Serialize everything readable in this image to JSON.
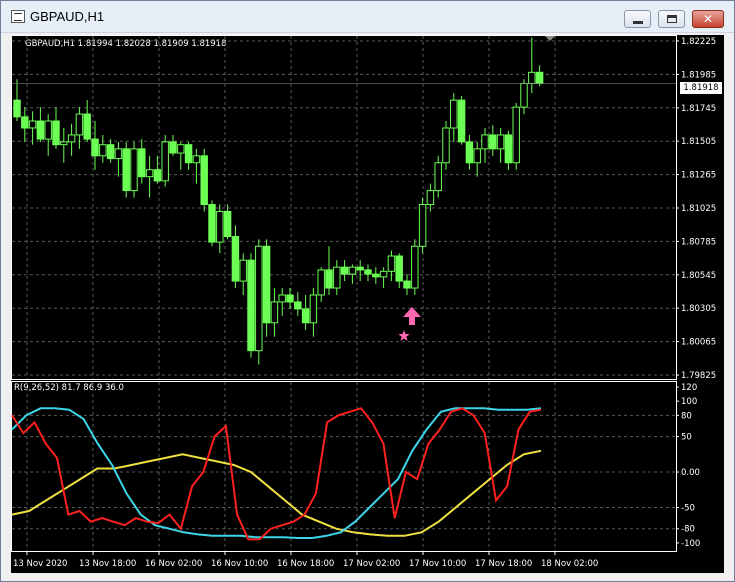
{
  "window": {
    "title": "GBPAUD,H1"
  },
  "price_chart": {
    "header": "GBPAUD,H1  1.81994 1.82028 1.81909 1.81918",
    "current_price": "1.81918",
    "price_axis": [
      "1.82225",
      "1.81985",
      "1.81745",
      "1.81505",
      "1.81265",
      "1.81025",
      "1.80785",
      "1.80545",
      "1.80305",
      "1.80065",
      "1.79825"
    ],
    "bull_color": "#6cff54",
    "candle_color_note": "green outline candles",
    "arrow_color": "#ff69b4",
    "star_color": "#ff69b4"
  },
  "indicator": {
    "header": "R(9,26,52) 81.7 86.9 36.0",
    "axis": [
      "120",
      "100",
      "80",
      "50",
      "0.00",
      "-50",
      "-80",
      "-100"
    ],
    "line_colors": [
      "#ff2020",
      "#3cd6e8",
      "#f0e040"
    ]
  },
  "time_axis": [
    "13 Nov 2020",
    "13 Nov 18:00",
    "16 Nov 02:00",
    "16 Nov 10:00",
    "16 Nov 18:00",
    "17 Nov 02:00",
    "17 Nov 10:00",
    "17 Nov 18:00",
    "18 Nov 02:00"
  ],
  "chart_data": {
    "type": "candlestick",
    "candles": [
      [
        1.818,
        1.8195,
        1.8165,
        1.8168
      ],
      [
        1.8168,
        1.8175,
        1.815,
        1.816
      ],
      [
        1.816,
        1.8172,
        1.8148,
        1.8165
      ],
      [
        1.8165,
        1.8175,
        1.815,
        1.8152
      ],
      [
        1.8152,
        1.817,
        1.814,
        1.8165
      ],
      [
        1.8165,
        1.8175,
        1.8145,
        1.8148
      ],
      [
        1.8148,
        1.816,
        1.8135,
        1.815
      ],
      [
        1.815,
        1.8163,
        1.814,
        1.8155
      ],
      [
        1.8155,
        1.8175,
        1.8145,
        1.817
      ],
      [
        1.817,
        1.818,
        1.815,
        1.8152
      ],
      [
        1.8152,
        1.8165,
        1.813,
        1.814
      ],
      [
        1.814,
        1.8155,
        1.8135,
        1.8148
      ],
      [
        1.8148,
        1.8152,
        1.8135,
        1.8138
      ],
      [
        1.8138,
        1.815,
        1.8125,
        1.8145
      ],
      [
        1.8145,
        1.815,
        1.811,
        1.8115
      ],
      [
        1.8115,
        1.815,
        1.811,
        1.8145
      ],
      [
        1.8145,
        1.8152,
        1.812,
        1.8125
      ],
      [
        1.8125,
        1.814,
        1.811,
        1.813
      ],
      [
        1.813,
        1.814,
        1.812,
        1.8122
      ],
      [
        1.8122,
        1.8155,
        1.8118,
        1.815
      ],
      [
        1.815,
        1.8155,
        1.814,
        1.8142
      ],
      [
        1.8142,
        1.815,
        1.813,
        1.8148
      ],
      [
        1.8148,
        1.815,
        1.813,
        1.8135
      ],
      [
        1.8135,
        1.8145,
        1.812,
        1.814
      ],
      [
        1.814,
        1.8145,
        1.81,
        1.8105
      ],
      [
        1.8105,
        1.8108,
        1.8075,
        1.8078
      ],
      [
        1.8078,
        1.8105,
        1.807,
        1.81
      ],
      [
        1.81,
        1.8105,
        1.808,
        1.8082
      ],
      [
        1.8082,
        1.809,
        1.8045,
        1.805
      ],
      [
        1.805,
        1.807,
        1.804,
        1.8065
      ],
      [
        1.8065,
        1.807,
        1.7995,
        1.8
      ],
      [
        1.8,
        1.808,
        1.799,
        1.8075
      ],
      [
        1.8075,
        1.808,
        1.801,
        1.802
      ],
      [
        1.802,
        1.8045,
        1.801,
        1.8035
      ],
      [
        1.8035,
        1.8045,
        1.8025,
        1.804
      ],
      [
        1.804,
        1.8045,
        1.803,
        1.8035
      ],
      [
        1.8035,
        1.8042,
        1.8025,
        1.803
      ],
      [
        1.803,
        1.804,
        1.8015,
        1.802
      ],
      [
        1.802,
        1.8045,
        1.801,
        1.804
      ],
      [
        1.804,
        1.806,
        1.8035,
        1.8058
      ],
      [
        1.8058,
        1.8075,
        1.804,
        1.8045
      ],
      [
        1.8045,
        1.8065,
        1.804,
        1.806
      ],
      [
        1.806,
        1.8065,
        1.805,
        1.8055
      ],
      [
        1.8055,
        1.8062,
        1.8048,
        1.806
      ],
      [
        1.806,
        1.8065,
        1.805,
        1.8058
      ],
      [
        1.8058,
        1.8062,
        1.805,
        1.8055
      ],
      [
        1.8055,
        1.806,
        1.8048,
        1.8053
      ],
      [
        1.8053,
        1.806,
        1.8045,
        1.8057
      ],
      [
        1.8057,
        1.8072,
        1.805,
        1.8068
      ],
      [
        1.8068,
        1.807,
        1.8045,
        1.805
      ],
      [
        1.805,
        1.8055,
        1.804,
        1.8045
      ],
      [
        1.8045,
        1.808,
        1.804,
        1.8075
      ],
      [
        1.8075,
        1.811,
        1.807,
        1.8105
      ],
      [
        1.8105,
        1.812,
        1.81,
        1.8115
      ],
      [
        1.8115,
        1.814,
        1.811,
        1.8135
      ],
      [
        1.8135,
        1.8165,
        1.813,
        1.816
      ],
      [
        1.816,
        1.8185,
        1.815,
        1.818
      ],
      [
        1.818,
        1.8183,
        1.8148,
        1.815
      ],
      [
        1.815,
        1.8155,
        1.813,
        1.8135
      ],
      [
        1.8135,
        1.815,
        1.8125,
        1.8145
      ],
      [
        1.8145,
        1.816,
        1.8135,
        1.8155
      ],
      [
        1.8155,
        1.8162,
        1.814,
        1.8145
      ],
      [
        1.8145,
        1.816,
        1.8135,
        1.8155
      ],
      [
        1.8155,
        1.8158,
        1.813,
        1.8135
      ],
      [
        1.8135,
        1.8178,
        1.813,
        1.8175
      ],
      [
        1.8175,
        1.8195,
        1.817,
        1.8192
      ],
      [
        1.8192,
        1.8225,
        1.8185,
        1.82
      ],
      [
        1.82,
        1.8205,
        1.819,
        1.8192
      ]
    ],
    "rsi_red": [
      80,
      55,
      70,
      40,
      20,
      -60,
      -55,
      -70,
      -65,
      -70,
      -75,
      -65,
      -70,
      -72,
      -60,
      -80,
      -20,
      0,
      50,
      65,
      -60,
      -95,
      -95,
      -80,
      -75,
      -70,
      -60,
      -30,
      70,
      80,
      85,
      90,
      70,
      40,
      -65,
      0,
      -10,
      40,
      60,
      85,
      90,
      80,
      55,
      -40,
      -20,
      60,
      85,
      88
    ],
    "rsi_cyan": [
      60,
      80,
      90,
      90,
      88,
      75,
      40,
      10,
      -30,
      -60,
      -75,
      -80,
      -85,
      -88,
      -90,
      -90,
      -90,
      -92,
      -92,
      -92,
      -93,
      -93,
      -90,
      -85,
      -70,
      -50,
      -30,
      -10,
      30,
      60,
      85,
      90,
      90,
      90,
      88,
      88,
      88,
      90
    ],
    "rsi_yellow": [
      -60,
      -55,
      -40,
      -25,
      -10,
      5,
      5,
      10,
      15,
      20,
      25,
      20,
      15,
      10,
      0,
      -20,
      -40,
      -60,
      -70,
      -80,
      -85,
      -88,
      -90,
      -90,
      -85,
      -70,
      -50,
      -30,
      -10,
      10,
      25,
      30
    ]
  }
}
